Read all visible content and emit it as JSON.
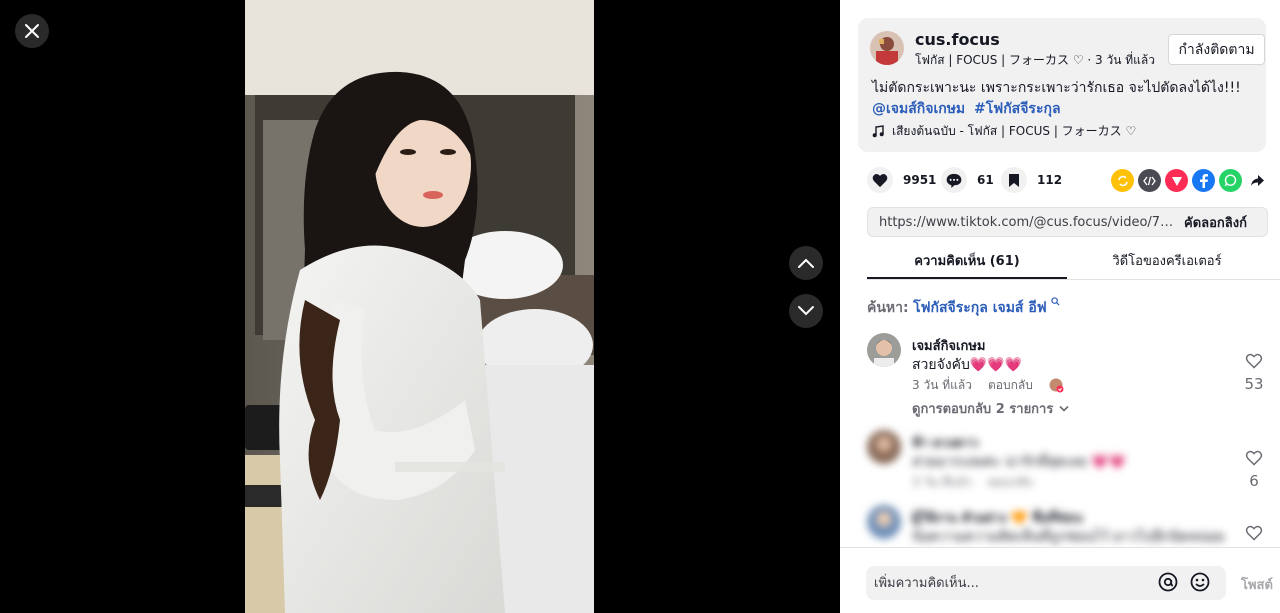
{
  "video": {
    "close_icon": "close-icon",
    "nav_up_icon": "chevron-up-icon",
    "nav_down_icon": "chevron-down-icon"
  },
  "author": {
    "username": "cus.focus",
    "subtitle": "โฟกัส | FOCUS | フォーカス ♡ · 3 วัน ที่แล้ว",
    "follow_label": "กำลังติดตาม"
  },
  "caption": {
    "text": "ไม่ตัดกระเพาะนะ เพราะกระเพาะว่ารักเธอ จะไปตัดลงได้ไง!!!",
    "mention": "@เจมส์กิจเกษม",
    "hashtag": "#โฟกัสจีระกุล",
    "music": "เสียงต้นฉบับ - โฟกัส | FOCUS | フォーカス ♡"
  },
  "actions": {
    "likes": "9951",
    "comments": "61",
    "saves": "112"
  },
  "share": {
    "link": "https://www.tiktok.com/@cus.focus/video/7535379535...",
    "copy_label": "คัดลอกลิงก์"
  },
  "tabs": {
    "comments": "ความคิดเห็น (61)",
    "creator_videos": "วิดีโอของครีเอเตอร์"
  },
  "search": {
    "label": "ค้นหา:",
    "term": "โฟกัสจีระกุล เจมส์ อีฟ"
  },
  "comments": [
    {
      "name": "เจมส์กิจเกษม",
      "text": "สวยจังคับ💗💗💗",
      "time": "3 วัน ที่แล้ว",
      "reply": "ตอบกลับ",
      "likes": "53",
      "view_replies": "ดูการตอบกลับ 2 รายการ"
    },
    {
      "name": "ฟ้า ดวงดาว",
      "text": "สวยมากเลยค่ะ น่ารักที่สุดเลย 💗💗",
      "time": "3 วัน ที่แล้ว",
      "reply": "ตอบกลับ",
      "likes": "6"
    },
    {
      "name": "ผู้ใช้งาน ตัวอย่าง 🧡 ชื่อที่ซ่อน",
      "text": "ข้อความความคิดเห็นที่ถูกซ่อนไว้ ยาวไปอีกนิดหน่อย",
      "likes": ""
    }
  ],
  "composer": {
    "placeholder": "เพิ่มความคิดเห็น...",
    "post_label": "โพสต์"
  }
}
